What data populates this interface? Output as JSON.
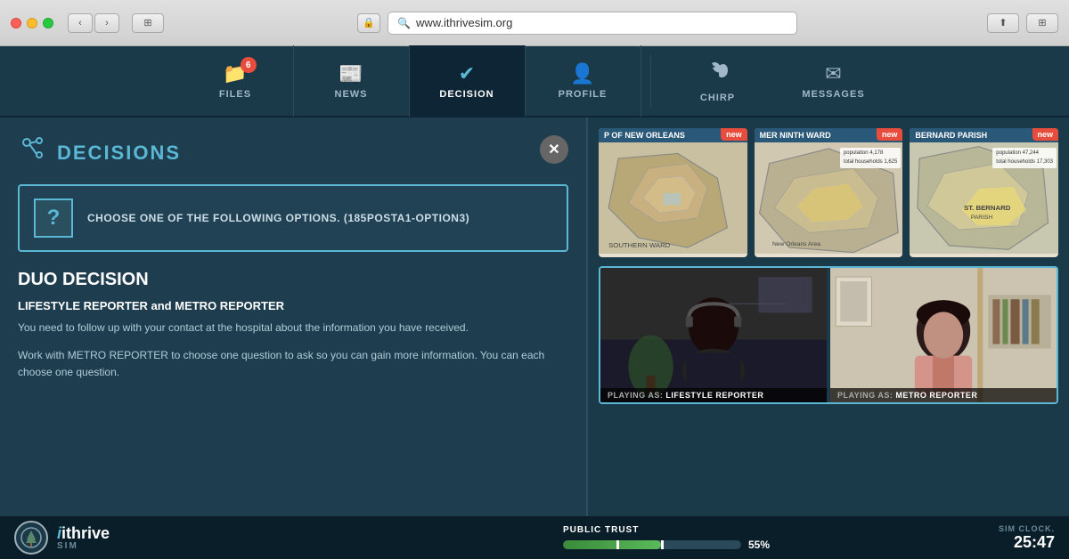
{
  "browser": {
    "url": "www.ithrivesim.org",
    "traffic_lights": [
      "red",
      "yellow",
      "green"
    ],
    "nav_back": "‹",
    "nav_forward": "›"
  },
  "navbar": {
    "items": [
      {
        "id": "files",
        "label": "FILES",
        "icon": "📁",
        "badge": "6",
        "active": false
      },
      {
        "id": "news",
        "label": "NEWS",
        "icon": "📰",
        "badge": null,
        "active": false
      },
      {
        "id": "decision",
        "label": "DECISION",
        "icon": "✔",
        "badge": null,
        "active": true
      },
      {
        "id": "profile",
        "label": "PROFILE",
        "icon": "👤",
        "badge": null,
        "active": false
      },
      {
        "id": "chirp",
        "label": "CHIRP",
        "icon": "🐦",
        "badge": null,
        "active": false
      },
      {
        "id": "messages",
        "label": "MESSAGES",
        "icon": "✉",
        "badge": null,
        "active": false
      }
    ]
  },
  "decisions": {
    "section_title": "DECISIONS",
    "question_text": "CHOOSE ONE OF THE FOLLOWING OPTIONS. (185POSTA1-OPTION3)",
    "duo_title": "DUO DECISION",
    "reporters_label": "LIFESTYLE REPORTER and METRO REPORTER",
    "desc1": "You need to follow up with your contact at the hospital about the information you have received.",
    "desc2": "Work with METRO REPORTER to choose one question to ask so you can gain more information. You can each choose one question."
  },
  "map_cards": [
    {
      "id": "map1",
      "header": "P OF NEW ORLEANS",
      "new": true
    },
    {
      "id": "map2",
      "header": "MER NINTH WARD",
      "new": true
    },
    {
      "id": "map3",
      "header": "BERNARD PARISH",
      "new": true
    }
  ],
  "video_panes": [
    {
      "id": "lifestyle",
      "label": "PLAYING AS:",
      "role": "LIFESTYLE REPORTER"
    },
    {
      "id": "metro",
      "label": "PLAYING AS:",
      "role": "METRO REPORTER"
    }
  ],
  "bottom_bar": {
    "logo_name": "ithrive",
    "logo_sub": "SIM",
    "trust_label": "PUBLIC TRUST",
    "trust_pct": "55%",
    "trust_value": 55,
    "sim_clock_label": "SIM CLOCK.",
    "sim_clock_time": "25:47"
  }
}
